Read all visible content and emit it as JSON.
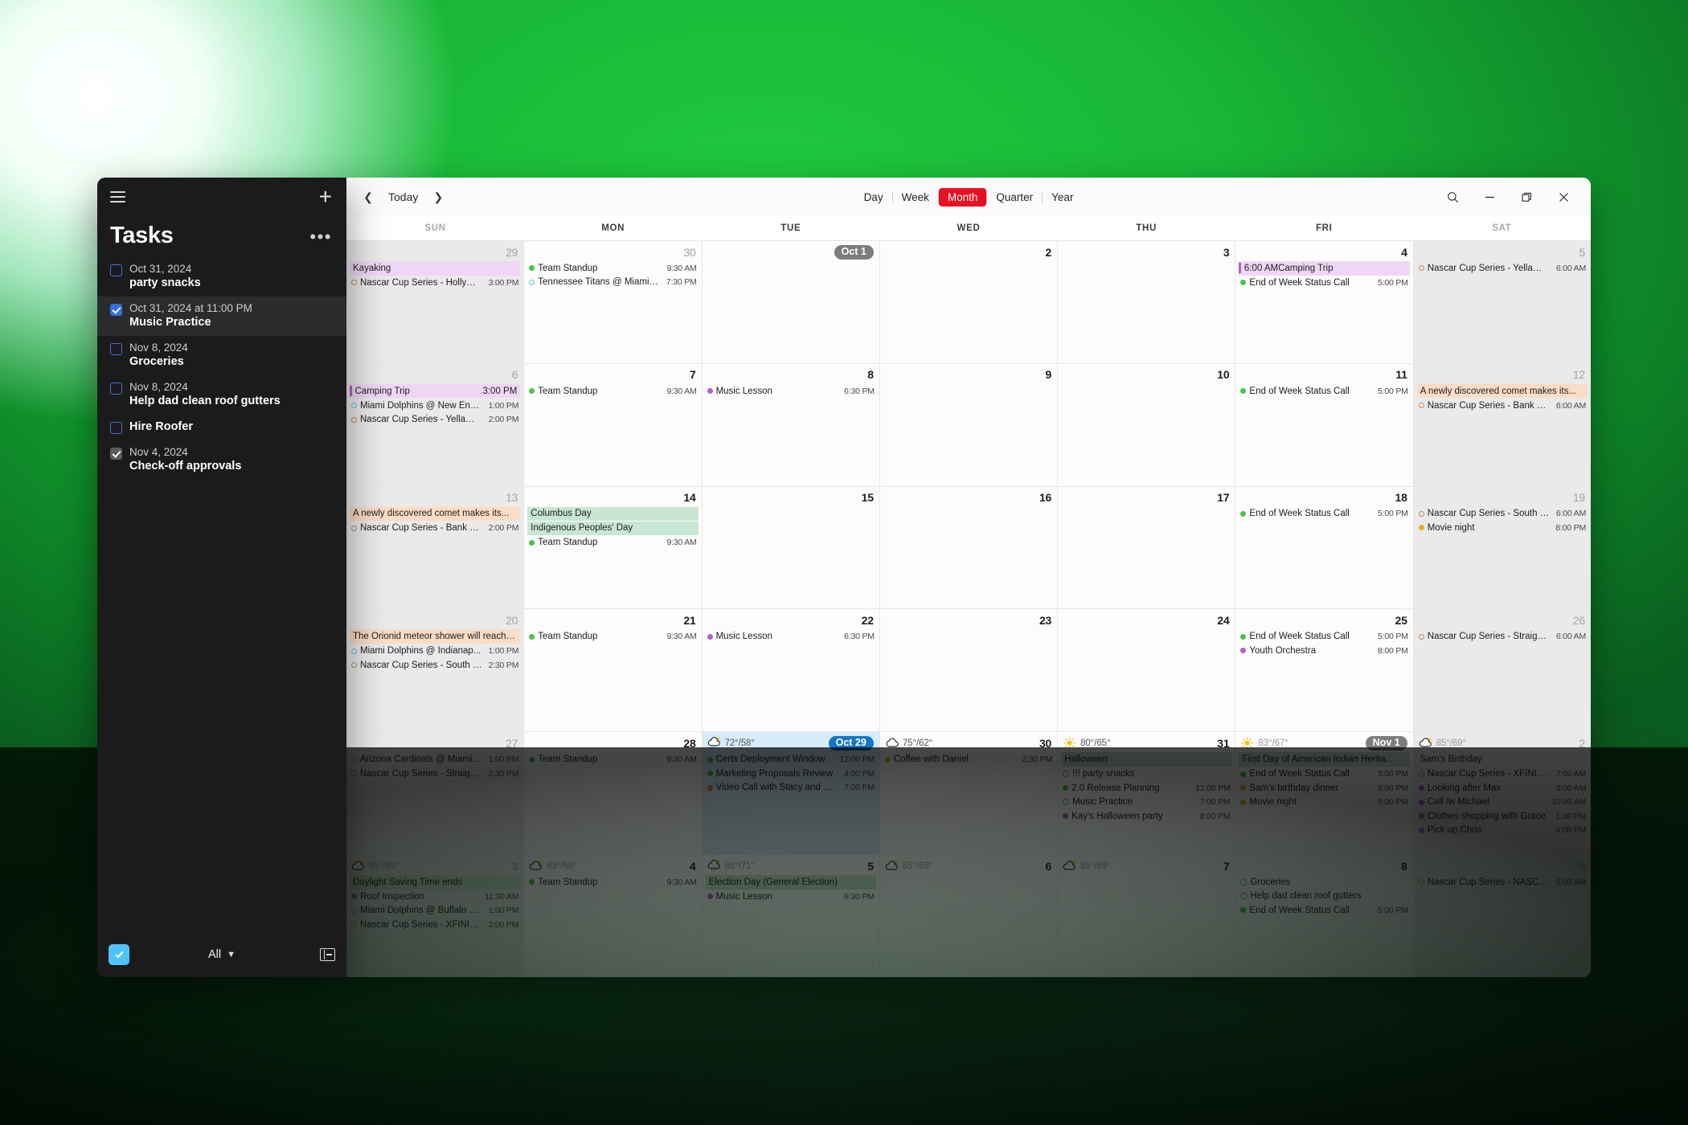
{
  "tasks_panel": {
    "title": "Tasks",
    "hamburger_icon": "hamburger-menu-icon",
    "add_icon": "plus-icon",
    "more_icon": "ellipsis-icon",
    "items": [
      {
        "date": "Oct 31, 2024",
        "name": "party snacks",
        "state": "unchecked"
      },
      {
        "date": "Oct 31, 2024 at 11:00 PM",
        "name": "Music Practice",
        "state": "checked-blue",
        "selected": true
      },
      {
        "date": "Nov 8, 2024",
        "name": "Groceries",
        "state": "unchecked"
      },
      {
        "date": "Nov 8, 2024",
        "name": "Help dad clean roof gutters",
        "state": "unchecked"
      },
      {
        "date": "",
        "name": "Hire Roofer",
        "state": "unchecked"
      },
      {
        "date": "Nov 4, 2024",
        "name": "Check-off approvals",
        "state": "checked-grey"
      }
    ],
    "footer": {
      "complete_icon": "check-square-icon",
      "filter_label": "All",
      "filter_chevron": "chevron-down-icon",
      "layout_icon": "panel-toggle-icon"
    }
  },
  "calendar": {
    "titlebar": {
      "prev_icon": "chevron-left-icon",
      "today_label": "Today",
      "next_icon": "chevron-right-icon",
      "views": [
        "Day",
        "Week",
        "Month",
        "Quarter",
        "Year"
      ],
      "active_view": "Month",
      "active_color": "#e81123",
      "search_icon": "search-icon",
      "minimize_icon": "minimize-icon",
      "restore_icon": "restore-icon",
      "close_icon": "close-icon"
    },
    "day_headers": [
      "SUN",
      "MON",
      "TUE",
      "WED",
      "THU",
      "FRI",
      "SAT"
    ],
    "weeks": [
      [
        {
          "day": "29",
          "dim": true,
          "weekend": true,
          "events": [
            {
              "kind": "banner",
              "style": "purple",
              "title": "Kayaking"
            },
            {
              "kind": "event",
              "marker": "ring",
              "title": "Nascar Cup Series - Hollywo...",
              "time": "3:00 PM"
            }
          ]
        },
        {
          "day": "30",
          "dim": true,
          "events": [
            {
              "kind": "event",
              "marker": "dot-green",
              "title": "Team Standup",
              "time": "9:30 AM"
            },
            {
              "kind": "event",
              "marker": "ring-blue",
              "title": "Tennessee Titans @ Miami D...",
              "time": "7:30 PM"
            }
          ]
        },
        {
          "day": "Oct 1",
          "pill": "grey",
          "events": []
        },
        {
          "day": "2",
          "events": []
        },
        {
          "day": "3",
          "events": []
        },
        {
          "day": "4",
          "events": [
            {
              "kind": "banner",
              "style": "purple-bar",
              "pretime": "6:00 AM",
              "title": "Camping Trip"
            },
            {
              "kind": "event",
              "marker": "dot-green",
              "title": "End of Week Status Call",
              "time": "5:00 PM"
            }
          ]
        },
        {
          "day": "5",
          "dim": true,
          "weekend": true,
          "events": [
            {
              "kind": "event",
              "marker": "ring",
              "title": "Nascar Cup Series - YellaWo...",
              "time": "6:00 AM"
            }
          ]
        }
      ],
      [
        {
          "day": "6",
          "dim": true,
          "weekend": true,
          "events": [
            {
              "kind": "banner",
              "style": "purple-bar",
              "title": "Camping Trip",
              "time": "3:00 PM"
            },
            {
              "kind": "event",
              "marker": "ring-blue",
              "title": "Miami Dolphins @ New Engl...",
              "time": "1:00 PM"
            },
            {
              "kind": "event",
              "marker": "ring",
              "title": "Nascar Cup Series - YellaWo...",
              "time": "2:00 PM"
            }
          ]
        },
        {
          "day": "7",
          "events": [
            {
              "kind": "event",
              "marker": "dot-green",
              "title": "Team Standup",
              "time": "9:30 AM"
            }
          ]
        },
        {
          "day": "8",
          "events": [
            {
              "kind": "event",
              "marker": "dot-purple",
              "title": "Music Lesson",
              "time": "6:30 PM"
            }
          ]
        },
        {
          "day": "9",
          "events": []
        },
        {
          "day": "10",
          "events": []
        },
        {
          "day": "11",
          "events": [
            {
              "kind": "event",
              "marker": "dot-green",
              "title": "End of Week Status Call",
              "time": "5:00 PM"
            }
          ]
        },
        {
          "day": "12",
          "dim": true,
          "weekend": true,
          "events": [
            {
              "kind": "banner",
              "style": "orange",
              "title": "A newly discovered comet makes its..."
            },
            {
              "kind": "event",
              "marker": "ring",
              "title": "Nascar Cup Series - Bank of...",
              "time": "6:00 AM"
            }
          ]
        }
      ],
      [
        {
          "day": "13",
          "dim": true,
          "weekend": true,
          "events": [
            {
              "kind": "banner",
              "style": "orange",
              "title": "A newly discovered comet makes its..."
            },
            {
              "kind": "event",
              "marker": "ring",
              "title": "Nascar Cup Series - Bank of...",
              "time": "2:00 PM"
            }
          ]
        },
        {
          "day": "14",
          "events": [
            {
              "kind": "banner",
              "style": "green",
              "title": "Columbus Day"
            },
            {
              "kind": "banner",
              "style": "green",
              "title": "Indigenous Peoples' Day"
            },
            {
              "kind": "event",
              "marker": "dot-green",
              "title": "Team Standup",
              "time": "9:30 AM"
            }
          ]
        },
        {
          "day": "15",
          "events": []
        },
        {
          "day": "16",
          "events": []
        },
        {
          "day": "17",
          "events": []
        },
        {
          "day": "18",
          "events": [
            {
              "kind": "event",
              "marker": "dot-green",
              "title": "End of Week Status Call",
              "time": "5:00 PM"
            }
          ]
        },
        {
          "day": "19",
          "dim": true,
          "weekend": true,
          "events": [
            {
              "kind": "event",
              "marker": "ring",
              "title": "Nascar Cup Series - South P...",
              "time": "6:00 AM"
            },
            {
              "kind": "event",
              "marker": "dot-yellow",
              "title": "Movie night",
              "time": "8:00 PM"
            }
          ]
        }
      ],
      [
        {
          "day": "20",
          "dim": true,
          "weekend": true,
          "events": [
            {
              "kind": "banner",
              "style": "orange",
              "title": "The Orionid meteor shower will reach its peak."
            },
            {
              "kind": "event",
              "marker": "ring-blue",
              "title": "Miami Dolphins @ Indianap...",
              "time": "1:00 PM"
            },
            {
              "kind": "event",
              "marker": "ring",
              "title": "Nascar Cup Series - South Po...",
              "time": "2:30 PM"
            }
          ]
        },
        {
          "day": "21",
          "events": [
            {
              "kind": "event",
              "marker": "dot-green",
              "title": "Team Standup",
              "time": "9:30 AM"
            }
          ]
        },
        {
          "day": "22",
          "events": [
            {
              "kind": "event",
              "marker": "dot-purple",
              "title": "Music Lesson",
              "time": "6:30 PM"
            }
          ]
        },
        {
          "day": "23",
          "events": []
        },
        {
          "day": "24",
          "events": []
        },
        {
          "day": "25",
          "events": [
            {
              "kind": "event",
              "marker": "dot-green",
              "title": "End of Week Status Call",
              "time": "5:00 PM"
            },
            {
              "kind": "event",
              "marker": "dot-purple",
              "title": "Youth Orchestra",
              "time": "8:00 PM"
            }
          ]
        },
        {
          "day": "26",
          "dim": true,
          "weekend": true,
          "events": [
            {
              "kind": "event",
              "marker": "ring",
              "title": "Nascar Cup Series - Straight...",
              "time": "6:00 AM"
            }
          ]
        }
      ],
      [
        {
          "day": "27",
          "dim": true,
          "weekend": true,
          "events": [
            {
              "kind": "event",
              "marker": "ring-blue",
              "title": "Arizona Cardinals @ Miami...",
              "time": "1:00 PM"
            },
            {
              "kind": "event",
              "marker": "ring",
              "title": "Nascar Cup Series - Straight...",
              "time": "2:30 PM"
            }
          ]
        },
        {
          "day": "28",
          "events": [
            {
              "kind": "event",
              "marker": "dot-green",
              "title": "Team Standup",
              "time": "9:30 AM"
            }
          ]
        },
        {
          "day": "Oct 29",
          "pill": "blue",
          "today": true,
          "weather": {
            "icon": "rain-cloud-icon",
            "temps": "72°/58°"
          },
          "events": [
            {
              "kind": "event",
              "marker": "dot-green",
              "title": "Certs Deployment Window",
              "time": "12:00 PM"
            },
            {
              "kind": "event",
              "marker": "dot-green",
              "title": "Marketing Proposals Review",
              "time": "4:00 PM"
            },
            {
              "kind": "event",
              "marker": "dot-multi",
              "title": "Video Call with Stacy and Mi...",
              "time": "7:00 PM"
            }
          ]
        },
        {
          "day": "30",
          "weather": {
            "icon": "cloud-icon",
            "temps": "75°/62°"
          },
          "events": [
            {
              "kind": "event",
              "marker": "dot-yellow",
              "title": "Coffee with Daniel",
              "time": "2:30 PM"
            }
          ]
        },
        {
          "day": "31",
          "weather": {
            "icon": "sun-icon",
            "temps": "80°/65°"
          },
          "events": [
            {
              "kind": "banner",
              "style": "green",
              "title": "Halloween"
            },
            {
              "kind": "event",
              "marker": "ring-task",
              "title": "!!! party snacks",
              "time": ""
            },
            {
              "kind": "event",
              "marker": "dot-green",
              "title": "2.0 Release Planning",
              "time": "12:00 PM"
            },
            {
              "kind": "event",
              "marker": "ring-task",
              "title": "Music Practice",
              "time": "7:00 PM"
            },
            {
              "kind": "event",
              "marker": "dot-purple",
              "title": "Kay's Halloween party",
              "time": "8:00 PM"
            }
          ]
        },
        {
          "day": "Nov 1",
          "pill": "grey",
          "weather": {
            "icon": "sun-icon",
            "temps": "83°/67°",
            "dim": true
          },
          "events": [
            {
              "kind": "banner",
              "style": "green",
              "title": "First Day of American Indian Herita..."
            },
            {
              "kind": "event",
              "marker": "dot-green",
              "title": "End of Week Status Call",
              "time": "5:00 PM"
            },
            {
              "kind": "event",
              "marker": "dot-yellow",
              "title": "Sam's birthday dinner",
              "time": "6:00 PM"
            },
            {
              "kind": "event",
              "marker": "dot-yellow",
              "title": "Movie night",
              "time": "8:00 PM"
            }
          ]
        },
        {
          "day": "2",
          "dim": true,
          "weekend": true,
          "weather": {
            "icon": "partly-cloudy-icon",
            "temps": "85°/69°",
            "dim": true
          },
          "events": [
            {
              "kind": "banner",
              "style": "none",
              "title": "Sam's Birthday"
            },
            {
              "kind": "event",
              "marker": "ring",
              "title": "Nascar Cup Series - XFINITY...",
              "time": "7:00 AM"
            },
            {
              "kind": "event",
              "marker": "dot-purple",
              "title": "Looking after Max",
              "time": "9:00 AM"
            },
            {
              "kind": "event",
              "marker": "dot-purple",
              "title": "Call /w Michael",
              "time": "10:00 AM"
            },
            {
              "kind": "event",
              "marker": "dot-purple",
              "title": "Clothes shopping with Grace",
              "time": "1:30 PM"
            },
            {
              "kind": "event",
              "marker": "dot-purple",
              "title": "Pick up Chris",
              "time": "4:00 PM"
            }
          ]
        }
      ],
      [
        {
          "day": "3",
          "dim": true,
          "weekend": true,
          "weather": {
            "icon": "partly-cloudy-icon",
            "temps": "85°/69°",
            "dim": true
          },
          "events": [
            {
              "kind": "banner",
              "style": "green",
              "title": "Daylight Saving Time ends"
            },
            {
              "kind": "event",
              "marker": "dot-purple",
              "title": "Roof Inspection",
              "time": "11:30 AM"
            },
            {
              "kind": "event",
              "marker": "ring-blue",
              "title": "Miami Dolphins @ Buffalo Bills",
              "time": "1:00 PM"
            },
            {
              "kind": "event",
              "marker": "ring",
              "title": "Nascar Cup Series - XFINITY...",
              "time": "2:00 PM"
            }
          ]
        },
        {
          "day": "4",
          "weather": {
            "icon": "partly-cloudy-icon",
            "temps": "83°/69°",
            "dim": true
          },
          "events": [
            {
              "kind": "event",
              "marker": "dot-green",
              "title": "Team Standup",
              "time": "9:30 AM"
            }
          ]
        },
        {
          "day": "5",
          "weather": {
            "icon": "rain-cloud-icon",
            "temps": "88°/71°",
            "dim": true
          },
          "events": [
            {
              "kind": "banner",
              "style": "green",
              "title": "Election Day (General Election)"
            },
            {
              "kind": "event",
              "marker": "dot-purple",
              "title": "Music Lesson",
              "time": "6:30 PM"
            }
          ]
        },
        {
          "day": "6",
          "weather": {
            "icon": "partly-cloudy-icon",
            "temps": "85°/69°",
            "dim": true
          },
          "events": []
        },
        {
          "day": "7",
          "weather": {
            "icon": "partly-cloudy-icon",
            "temps": "85°/69°",
            "dim": true
          },
          "events": []
        },
        {
          "day": "8",
          "events": [
            {
              "kind": "event",
              "marker": "ring-task",
              "title": "Groceries",
              "time": ""
            },
            {
              "kind": "event",
              "marker": "ring-task",
              "title": "Help dad clean roof gutters",
              "time": ""
            },
            {
              "kind": "event",
              "marker": "dot-green",
              "title": "End of Week Status Call",
              "time": "5:00 PM"
            }
          ]
        },
        {
          "day": "9",
          "dim": true,
          "weekend": true,
          "events": [
            {
              "kind": "event",
              "marker": "ring",
              "title": "Nascar Cup Series - NASCAR...",
              "time": "6:00 AM"
            }
          ]
        }
      ]
    ]
  }
}
